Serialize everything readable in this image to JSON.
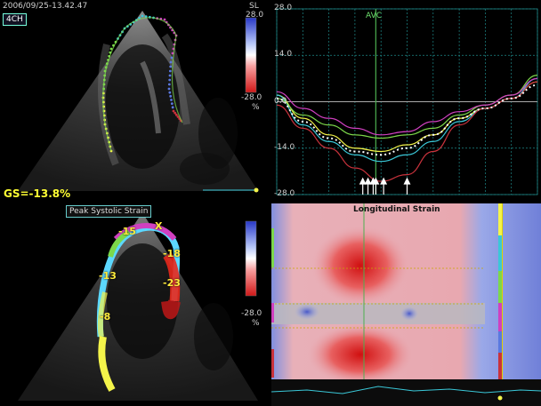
{
  "header": {
    "timestamp": "2006/09/25-13.42.47",
    "view_label": "4CH",
    "color_bar_title": "SL",
    "color_bar_max": "28.0",
    "color_bar_min": "-28.0",
    "color_bar_unit": "%",
    "bottom_bar_min": "-28.0",
    "bottom_bar_unit": "%"
  },
  "global_strain": "GS=-13.8%",
  "peak_label": "Peak Systolic Strain",
  "segment_values": [
    "-15",
    "X",
    "-18",
    "-13",
    "-23",
    "-8"
  ],
  "heatmap_title": "Longitudinal Strain",
  "colors": {
    "grid": "#1e8a8a",
    "avc": "#4caf50",
    "heat_positive": "#4f6ad0",
    "heat_negative": "#e02020",
    "trace_yellow": "#f4f44a",
    "trace_cyan": "#3ac8d8",
    "trace_green": "#7cd84a",
    "trace_magenta": "#d040c0",
    "trace_red": "#c8323c",
    "trace_blue": "#5a78e0"
  },
  "chart_data": {
    "type": "line",
    "title": "",
    "xlabel": "",
    "ylabel": "",
    "ylim": [
      -28.0,
      28.0
    ],
    "y_tick_labels": [
      "28.0",
      "14.0",
      "0.0",
      "-14.0",
      "-28.0"
    ],
    "annotations": [
      "AVC"
    ],
    "avc_x_fraction": 0.38,
    "arrow_x_fractions": [
      0.33,
      0.35,
      0.37,
      0.38,
      0.41,
      0.5
    ],
    "x": [
      0,
      0.1,
      0.2,
      0.3,
      0.4,
      0.5,
      0.6,
      0.7,
      0.8,
      0.9,
      1.0
    ],
    "series": [
      {
        "color": "#f4f44a",
        "values": [
          2,
          -5,
          -10,
          -14,
          -15,
          -13,
          -10,
          -5,
          -2,
          1,
          6
        ]
      },
      {
        "color": "#3ac8d8",
        "values": [
          2,
          -7,
          -12,
          -16,
          -18,
          -16,
          -12,
          -6,
          -2,
          1,
          7
        ]
      },
      {
        "color": "#7cd84a",
        "values": [
          1,
          -4,
          -7,
          -10,
          -11,
          -10,
          -8,
          -4,
          -1,
          2,
          8
        ]
      },
      {
        "color": "#d040c0",
        "values": [
          3,
          -2,
          -5,
          -8,
          -10,
          -9,
          -6,
          -3,
          -1,
          2,
          7
        ]
      },
      {
        "color": "#c8323c",
        "values": [
          -1,
          -8,
          -14,
          -20,
          -24,
          -22,
          -15,
          -7,
          -2,
          1,
          6
        ]
      },
      {
        "color": "#ffffff",
        "values": [
          1,
          -6,
          -11,
          -15,
          -16,
          -14,
          -10,
          -5,
          -2,
          1,
          5
        ]
      }
    ],
    "grid": true
  }
}
